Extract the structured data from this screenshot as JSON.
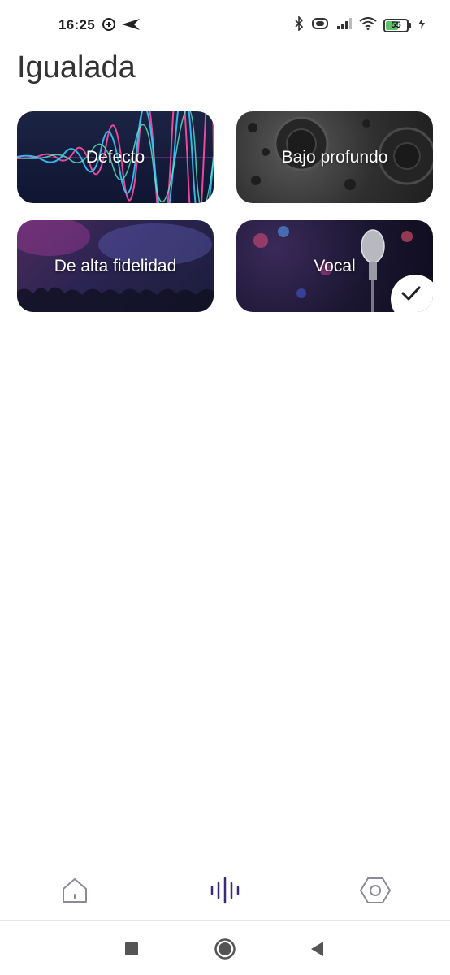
{
  "status_bar": {
    "time": "16:25",
    "battery_level": "55",
    "battery_color": "#5ec36a",
    "icons": [
      "vpn-icon",
      "send-icon",
      "bluetooth-icon",
      "vibrate-icon",
      "signal-icon",
      "wifi-icon",
      "battery-icon",
      "charging-icon"
    ]
  },
  "header": {
    "title": "Igualada"
  },
  "presets": [
    {
      "label": "Defecto",
      "selected": false
    },
    {
      "label": "Bajo profundo",
      "selected": false
    },
    {
      "label": "De alta fidelidad",
      "selected": false
    },
    {
      "label": "Vocal",
      "selected": true
    }
  ],
  "bottom_nav": {
    "items": [
      {
        "icon": "home-icon",
        "active": false
      },
      {
        "icon": "equalizer-icon",
        "active": true
      },
      {
        "icon": "settings-icon",
        "active": false
      }
    ],
    "active_color": "#3b2a7a",
    "inactive_color": "#8a8a9a"
  },
  "system_nav": {
    "icons": [
      "recent-apps-icon",
      "home-circle-icon",
      "back-icon"
    ]
  }
}
